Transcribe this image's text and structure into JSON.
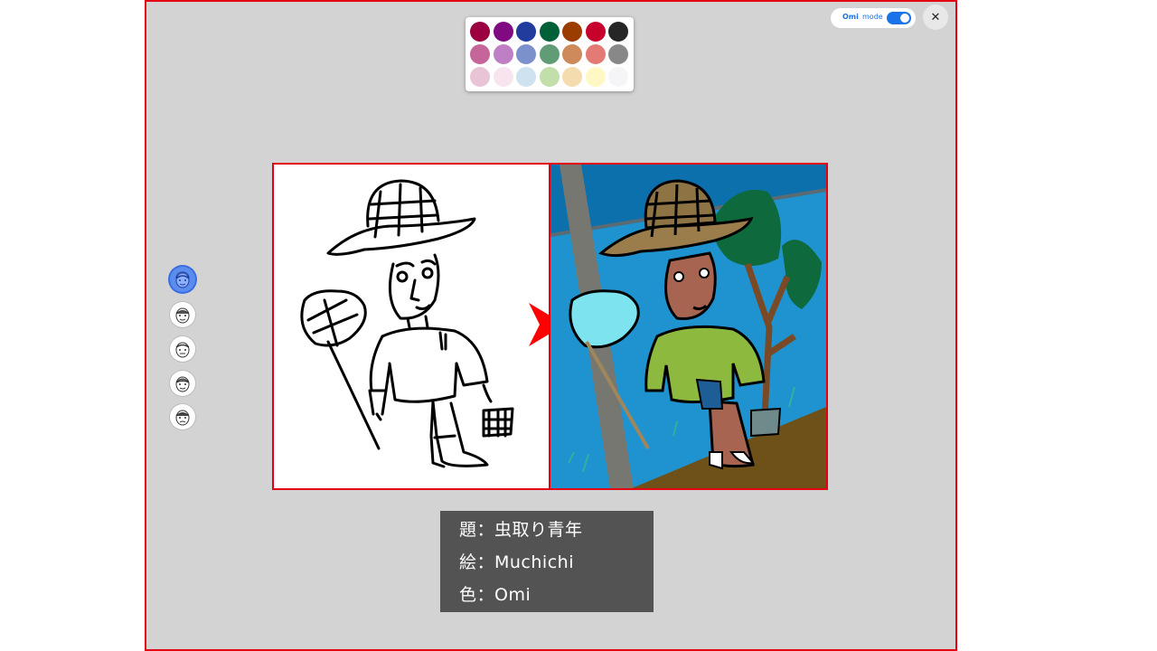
{
  "palette": {
    "colors": [
      "#9b0040",
      "#7f0a82",
      "#213c9c",
      "#006038",
      "#9b3c00",
      "#c8002c",
      "#262626",
      "#c6659a",
      "#bf7fc4",
      "#7b91cc",
      "#609d77",
      "#ce8a5a",
      "#e47a74",
      "#888888",
      "#e8c4d6",
      "#f8e4ef",
      "#cfe2ef",
      "#c2deaa",
      "#f5dcae",
      "#fff8c4",
      "#f5f5f7"
    ]
  },
  "toggle": {
    "brand": "Omi",
    "mode": "mode",
    "on": true,
    "accent": "#1a73e8"
  },
  "close": {
    "icon": "✕"
  },
  "avatars": {
    "count": 5,
    "active_index": 0
  },
  "caption": {
    "title": "題：虫取り青年",
    "artist": "絵：Muchichi",
    "colorist": "色：Omi"
  },
  "colors": {
    "frame_border": "#e60012",
    "background": "#d3d3d3"
  }
}
